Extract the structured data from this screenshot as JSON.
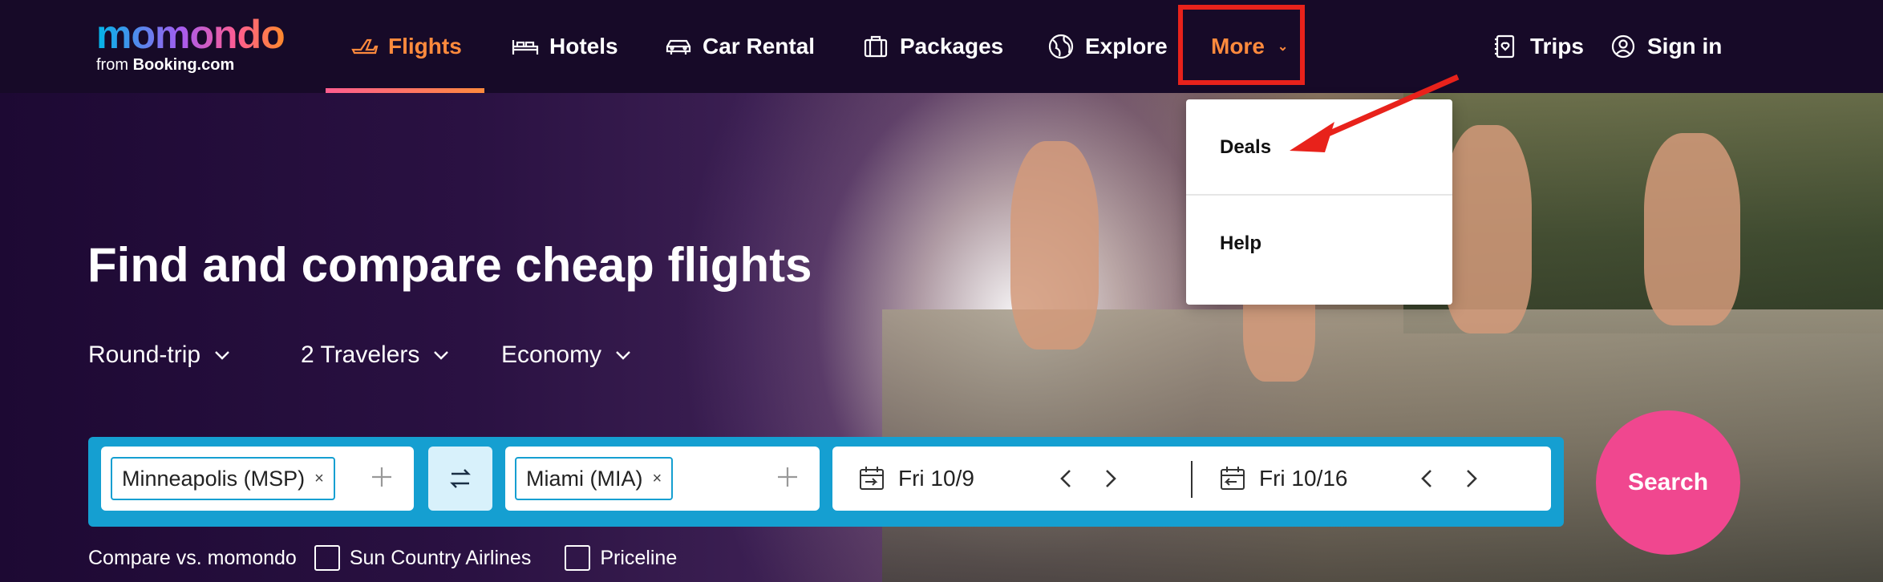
{
  "logo": {
    "word": "momondo",
    "sub_prefix": "from ",
    "sub_brand": "Booking.com"
  },
  "nav": {
    "items": [
      {
        "label": "Flights",
        "icon": "plane-icon"
      },
      {
        "label": "Hotels",
        "icon": "bed-icon"
      },
      {
        "label": "Car Rental",
        "icon": "car-icon"
      },
      {
        "label": "Packages",
        "icon": "suitcase-icon"
      },
      {
        "label": "Explore",
        "icon": "globe-icon"
      },
      {
        "label": "More",
        "icon": "chevron-down-icon"
      }
    ],
    "right": [
      {
        "label": "Trips",
        "icon": "trips-icon"
      },
      {
        "label": "Sign in",
        "icon": "user-icon"
      }
    ]
  },
  "dropdown": {
    "items": [
      "Deals",
      "Help"
    ]
  },
  "hero": {
    "title": "Find and compare cheap flights"
  },
  "options": {
    "trip_type": "Round-trip",
    "travelers": "2 Travelers",
    "cabin": "Economy"
  },
  "search": {
    "origin": "Minneapolis (MSP)",
    "destination": "Miami (MIA)",
    "depart": "Fri 10/9",
    "return": "Fri 10/16",
    "button": "Search"
  },
  "compare": {
    "label": "Compare vs. momondo",
    "options": [
      "Sun Country Airlines",
      "Priceline"
    ]
  },
  "colors": {
    "accent_orange": "#ff8a3d",
    "search_pink": "#f0478f",
    "bar_blue": "#159fd1",
    "annotation_red": "#e8221b"
  }
}
